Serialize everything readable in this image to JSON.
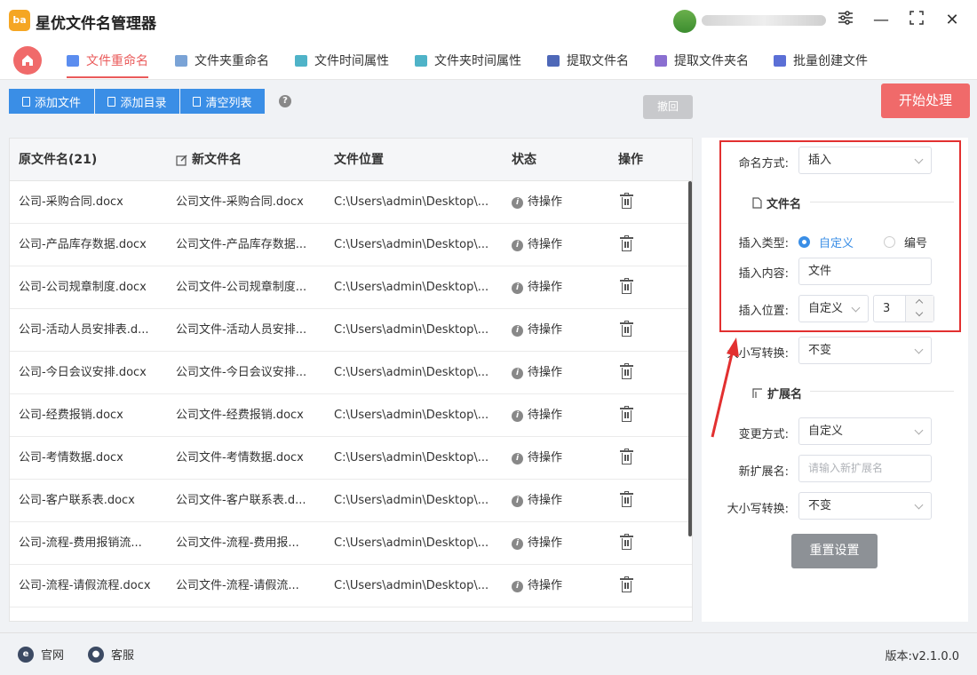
{
  "app": {
    "logo_text": "ba",
    "title": "星优文件名管理器"
  },
  "window_controls": {
    "settings_icon": "sliders-icon",
    "minimize": "—",
    "maximize": "⛶",
    "close": "✕"
  },
  "tabs": [
    {
      "label": "文件重命名",
      "active": true,
      "icon_color": "#5b8def"
    },
    {
      "label": "文件夹重命名",
      "active": false,
      "icon_color": "#7aa3d6"
    },
    {
      "label": "文件时间属性",
      "active": false,
      "icon_color": "#4fb3c8"
    },
    {
      "label": "文件夹时间属性",
      "active": false,
      "icon_color": "#4fb3c8"
    },
    {
      "label": "提取文件名",
      "active": false,
      "icon_color": "#4e68b8"
    },
    {
      "label": "提取文件夹名",
      "active": false,
      "icon_color": "#8a6fd1"
    },
    {
      "label": "批量创建文件",
      "active": false,
      "icon_color": "#5b6fd6"
    }
  ],
  "toolbar": {
    "add_file": "添加文件",
    "add_dir": "添加目录",
    "clear_list": "清空列表",
    "help": "?",
    "undo": "撤回",
    "start": "开始处理"
  },
  "table": {
    "headers": {
      "original": "原文件名(21)",
      "new": "新文件名",
      "location": "文件位置",
      "status": "状态",
      "action": "操作"
    },
    "rows": [
      {
        "original": "公司-采购合同.docx",
        "new": "公司文件-采购合同.docx",
        "location": "C:\\Users\\admin\\Desktop\\...",
        "status": "待操作"
      },
      {
        "original": "公司-产品库存数据.docx",
        "new": "公司文件-产品库存数据...",
        "location": "C:\\Users\\admin\\Desktop\\...",
        "status": "待操作"
      },
      {
        "original": "公司-公司规章制度.docx",
        "new": "公司文件-公司规章制度...",
        "location": "C:\\Users\\admin\\Desktop\\...",
        "status": "待操作"
      },
      {
        "original": "公司-活动人员安排表.d...",
        "new": "公司文件-活动人员安排...",
        "location": "C:\\Users\\admin\\Desktop\\...",
        "status": "待操作"
      },
      {
        "original": "公司-今日会议安排.docx",
        "new": "公司文件-今日会议安排...",
        "location": "C:\\Users\\admin\\Desktop\\...",
        "status": "待操作"
      },
      {
        "original": "公司-经费报销.docx",
        "new": "公司文件-经费报销.docx",
        "location": "C:\\Users\\admin\\Desktop\\...",
        "status": "待操作"
      },
      {
        "original": "公司-考情数据.docx",
        "new": "公司文件-考情数据.docx",
        "location": "C:\\Users\\admin\\Desktop\\...",
        "status": "待操作"
      },
      {
        "original": "公司-客户联系表.docx",
        "new": "公司文件-客户联系表.d...",
        "location": "C:\\Users\\admin\\Desktop\\...",
        "status": "待操作"
      },
      {
        "original": "公司-流程-费用报销流...",
        "new": "公司文件-流程-费用报...",
        "location": "C:\\Users\\admin\\Desktop\\...",
        "status": "待操作"
      },
      {
        "original": "公司-流程-请假流程.docx",
        "new": "公司文件-流程-请假流...",
        "location": "C:\\Users\\admin\\Desktop\\...",
        "status": "待操作"
      }
    ]
  },
  "panel": {
    "naming_method_label": "命名方式:",
    "naming_method_value": "插入",
    "filename_section": "文件名",
    "insert_type_label": "插入类型:",
    "insert_type_options": [
      "自定义",
      "编号"
    ],
    "insert_content_label": "插入内容:",
    "insert_content_value": "文件",
    "insert_position_label": "插入位置:",
    "insert_position_value": "自定义",
    "insert_position_number": "3",
    "case_label": "大小写转换:",
    "case_value": "不变",
    "ext_section": "扩展名",
    "change_method_label": "变更方式:",
    "change_method_value": "自定义",
    "new_ext_label": "新扩展名:",
    "new_ext_placeholder": "请输入新扩展名",
    "ext_case_label": "大小写转换:",
    "ext_case_value": "不变",
    "reset": "重置设置"
  },
  "footer": {
    "website": "官网",
    "support": "客服",
    "version": "版本:v2.1.0.0"
  },
  "colors": {
    "accent_red": "#f06a6a",
    "accent_blue": "#3a8ee6",
    "highlight": "#e23030"
  }
}
